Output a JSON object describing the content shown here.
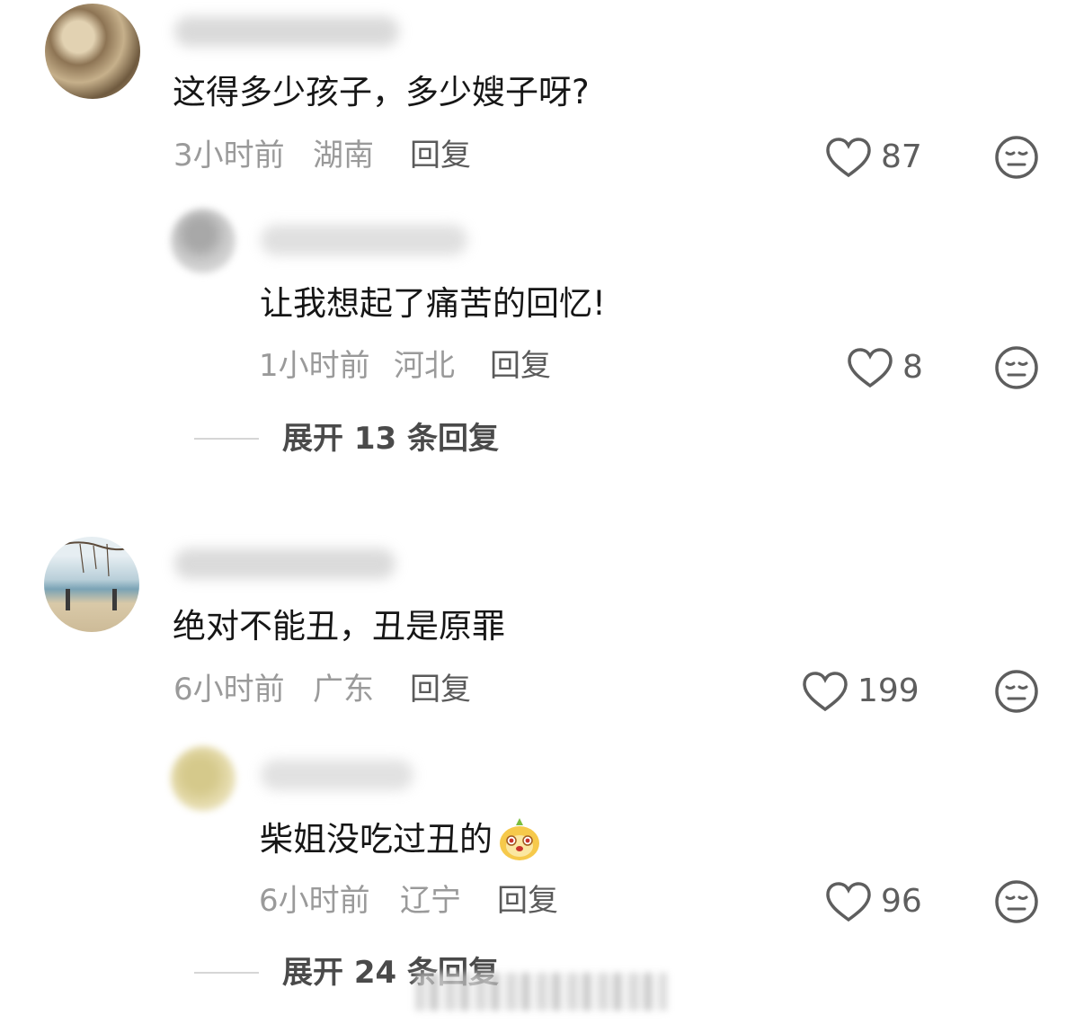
{
  "comments": [
    {
      "text": "这得多少孩子，多少嫂子呀?",
      "time": "3小时前",
      "location": "湖南",
      "reply_label": "回复",
      "likes": "87",
      "replies": [
        {
          "text": "让我想起了痛苦的回忆!",
          "time": "1小时前",
          "location": "河北",
          "reply_label": "回复",
          "likes": "8"
        }
      ],
      "expand_label": "展开 13 条回复"
    },
    {
      "text": "绝对不能丑，丑是原罪",
      "time": "6小时前",
      "location": "广东",
      "reply_label": "回复",
      "likes": "199",
      "replies": [
        {
          "text": "柴姐没吃过丑的",
          "time": "6小时前",
          "location": "辽宁",
          "reply_label": "回复",
          "likes": "96"
        }
      ],
      "expand_label": "展开 24 条回复"
    }
  ],
  "colors": {
    "text": "#161616",
    "meta": "#9a9a9a",
    "icon": "#5e5e5e"
  }
}
